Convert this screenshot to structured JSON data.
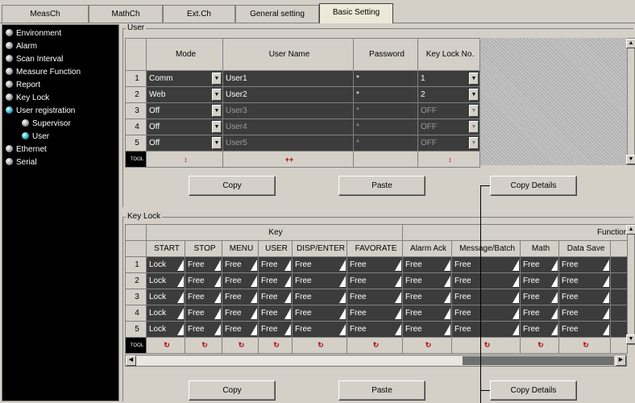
{
  "tabs": [
    "MeasCh",
    "MathCh",
    "Ext.Ch",
    "General setting",
    "Basic Setting"
  ],
  "sidebar": {
    "items": [
      {
        "label": "Environment",
        "active": false
      },
      {
        "label": "Alarm",
        "active": false
      },
      {
        "label": "Scan Interval",
        "active": false
      },
      {
        "label": "Measure Function",
        "active": false
      },
      {
        "label": "Report",
        "active": false
      },
      {
        "label": "Key Lock",
        "active": false
      },
      {
        "label": "User registration",
        "active": true
      },
      {
        "label": "Supervisor",
        "active": false
      },
      {
        "label": "User",
        "active": true
      },
      {
        "label": "Ethernet",
        "active": false
      },
      {
        "label": "Serial",
        "active": false
      }
    ]
  },
  "user_group": {
    "title": "User",
    "headers": [
      "Mode",
      "User Name",
      "Password",
      "Key Lock No."
    ],
    "rows": [
      {
        "no": "1",
        "mode": "Comm",
        "name": "User1",
        "password": "*",
        "keylock": "1",
        "enabled": true
      },
      {
        "no": "2",
        "mode": "Web",
        "name": "User2",
        "password": "*",
        "keylock": "2",
        "enabled": true
      },
      {
        "no": "3",
        "mode": "Off",
        "name": "User3",
        "password": "*",
        "keylock": "OFF",
        "enabled": false
      },
      {
        "no": "4",
        "mode": "Off",
        "name": "User4",
        "password": "*",
        "keylock": "OFF",
        "enabled": false
      },
      {
        "no": "5",
        "mode": "Off",
        "name": "User5",
        "password": "*",
        "keylock": "OFF",
        "enabled": false
      }
    ],
    "tool_label": "TOOL",
    "tool_marks": [
      "↕",
      "++",
      "",
      "↕"
    ],
    "buttons": {
      "copy": "Copy",
      "paste": "Paste",
      "copy_details": "Copy Details"
    }
  },
  "keylock_group": {
    "title": "Key Lock",
    "group_key": "Key",
    "group_function": "Functior",
    "headers": [
      "START",
      "STOP",
      "MENU",
      "USER",
      "DISP/ENTER",
      "FAVORATE",
      "Alarm Ack",
      "Message/Batch",
      "Math",
      "Data Save"
    ],
    "rows": [
      {
        "no": "1",
        "values": [
          "Lock",
          "Free",
          "Free",
          "Free",
          "Free",
          "Free",
          "Free",
          "Free",
          "Free",
          "Free"
        ]
      },
      {
        "no": "2",
        "values": [
          "Lock",
          "Free",
          "Free",
          "Free",
          "Free",
          "Free",
          "Free",
          "Free",
          "Free",
          "Free"
        ]
      },
      {
        "no": "3",
        "values": [
          "Lock",
          "Free",
          "Free",
          "Free",
          "Free",
          "Free",
          "Free",
          "Free",
          "Free",
          "Free"
        ]
      },
      {
        "no": "4",
        "values": [
          "Lock",
          "Free",
          "Free",
          "Free",
          "Free",
          "Free",
          "Free",
          "Free",
          "Free",
          "Free"
        ]
      },
      {
        "no": "5",
        "values": [
          "Lock",
          "Free",
          "Free",
          "Free",
          "Free",
          "Free",
          "Free",
          "Free",
          "Free",
          "Free"
        ]
      }
    ],
    "tool_label": "TOOL",
    "tool_mark": "↻",
    "buttons": {
      "copy": "Copy",
      "paste": "Paste",
      "copy_details": "Copy Details"
    }
  },
  "icons": [
    "dropdown-arrow-icon",
    "ramp-icon",
    "scroll-up-icon",
    "scroll-down-icon",
    "scroll-left-icon",
    "scroll-right-icon",
    "radio-dot-icon"
  ],
  "colors": {
    "cell_bg": "#3c3c3c",
    "active_dot": "#2ab0c8",
    "tool_mark": "#b00000"
  }
}
